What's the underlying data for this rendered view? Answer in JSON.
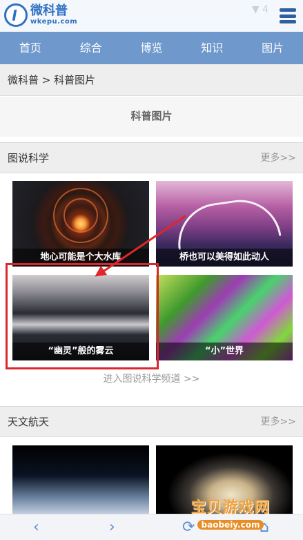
{
  "header": {
    "logo_main": "微科普",
    "logo_sub": "wkepu.com",
    "status": "▼ 4",
    "menu_icon": "hamburger-icon"
  },
  "nav": {
    "items": [
      "首页",
      "综合",
      "博览",
      "知识",
      "图片"
    ]
  },
  "breadcrumb": "微科普 > 科普图片",
  "page_heading": "科普图片",
  "section1": {
    "title": "图说科学",
    "more": "更多>>",
    "thumbs": [
      {
        "caption": "地心可能是个大水库"
      },
      {
        "caption": "桥也可以美得如此动人"
      },
      {
        "caption": "“幽灵”般的雾云"
      },
      {
        "caption": "“小”世界"
      }
    ],
    "channel_link": "进入图说科学频道 >>"
  },
  "section2": {
    "title": "天文航天",
    "more": "更多>>"
  },
  "bottombar": {
    "back_icon": "‹",
    "forward_icon": "›",
    "refresh_icon": "⟳",
    "home_icon": "⌂"
  },
  "watermark": {
    "main": "宝贝游戏网",
    "sub": "baobeiy.com"
  },
  "colors": {
    "nav_bg": "#6f98cc",
    "brand": "#2f72c4",
    "highlight": "#d9272d"
  }
}
